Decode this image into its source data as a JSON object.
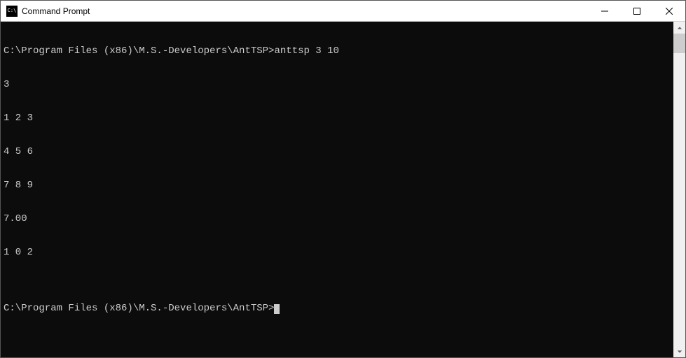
{
  "window": {
    "title": "Command Prompt"
  },
  "terminal": {
    "lines": [
      "C:\\Program Files (x86)\\M.S.-Developers\\AntTSP>anttsp 3 10",
      "3",
      "1 2 3",
      "4 5 6",
      "7 8 9",
      "7.00",
      "1 0 2",
      "",
      "C:\\Program Files (x86)\\M.S.-Developers\\AntTSP>"
    ],
    "prompt_path": "C:\\Program Files (x86)\\M.S.-Developers\\AntTSP",
    "command": "anttsp 3 10",
    "output": {
      "n": "3",
      "matrix": [
        "1 2 3",
        "4 5 6",
        "7 8 9"
      ],
      "cost": "7.00",
      "path": "1 0 2"
    }
  }
}
